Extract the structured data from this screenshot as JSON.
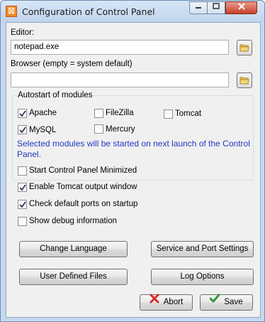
{
  "window": {
    "title": "Configuration of Control Panel",
    "app_icon_glyph": "⛝"
  },
  "editor": {
    "label": "Editor:",
    "value": "notepad.exe"
  },
  "browser": {
    "label": "Browser (empty = system default)",
    "value": ""
  },
  "autostart": {
    "title": "Autostart of modules",
    "modules": [
      {
        "label": "Apache",
        "checked": true
      },
      {
        "label": "FileZilla",
        "checked": false
      },
      {
        "label": "Tomcat",
        "checked": false
      },
      {
        "label": "MySQL",
        "checked": true
      },
      {
        "label": "Mercury",
        "checked": false
      }
    ],
    "note": "Selected modules will be started on next launch of the Control Panel."
  },
  "options": [
    {
      "label": "Start Control Panel Minimized",
      "checked": false
    },
    {
      "label": "Enable Tomcat output window",
      "checked": true
    },
    {
      "label": "Check default ports on startup",
      "checked": true
    },
    {
      "label": "Show debug information",
      "checked": false
    }
  ],
  "buttons": {
    "change_language": "Change Language",
    "service_port_settings": "Service and Port Settings",
    "user_defined_files": "User Defined Files",
    "log_options": "Log Options",
    "abort": "Abort",
    "save": "Save"
  },
  "colors": {
    "note_text": "#1f3bbf",
    "abort_icon": "#d22b2b",
    "save_icon": "#2e9a2e",
    "app_icon": "#f08a24"
  },
  "icons": {
    "folder": "folder-icon",
    "abort": "x-icon",
    "save": "checkmark-icon"
  }
}
